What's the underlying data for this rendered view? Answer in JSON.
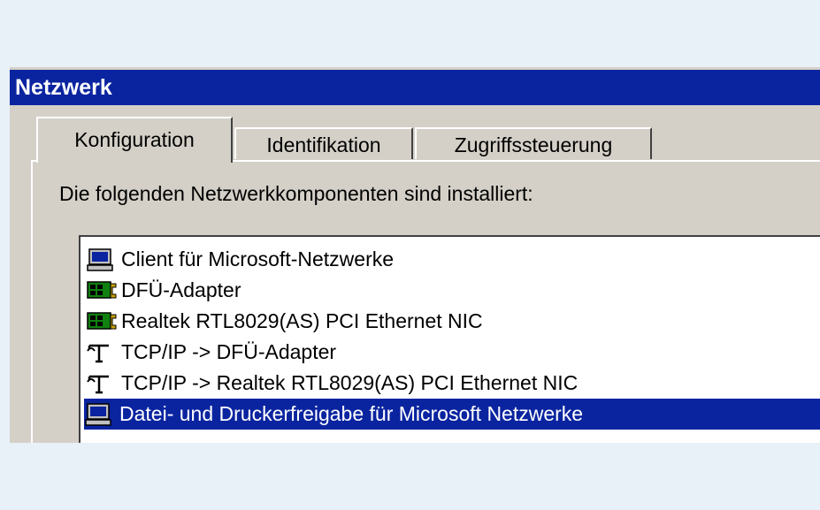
{
  "window": {
    "title": "Netzwerk"
  },
  "tabs": [
    {
      "label": "Konfiguration",
      "active": true
    },
    {
      "label": "Identifikation",
      "active": false
    },
    {
      "label": "Zugriffssteuerung",
      "active": false
    }
  ],
  "components_label": "Die folgenden Netzwerkkomponenten sind installiert:",
  "components": [
    {
      "label": "Client für Microsoft-Netzwerke",
      "icon": "network-client-icon",
      "selected": false
    },
    {
      "label": "DFÜ-Adapter",
      "icon": "network-adapter-icon",
      "selected": false
    },
    {
      "label": "Realtek RTL8029(AS) PCI Ethernet NIC",
      "icon": "network-adapter-icon",
      "selected": false
    },
    {
      "label": "TCP/IP -> DFÜ-Adapter",
      "icon": "protocol-icon",
      "selected": false
    },
    {
      "label": "TCP/IP -> Realtek RTL8029(AS) PCI Ethernet NIC",
      "icon": "protocol-icon",
      "selected": false
    },
    {
      "label": "Datei- und Druckerfreigabe für Microsoft Netzwerke",
      "icon": "file-printer-sharing-icon",
      "selected": true
    }
  ],
  "colors": {
    "titlebar": "#0a24a0",
    "selection": "#0a24a0",
    "dialog_face": "#d4d0c8"
  }
}
